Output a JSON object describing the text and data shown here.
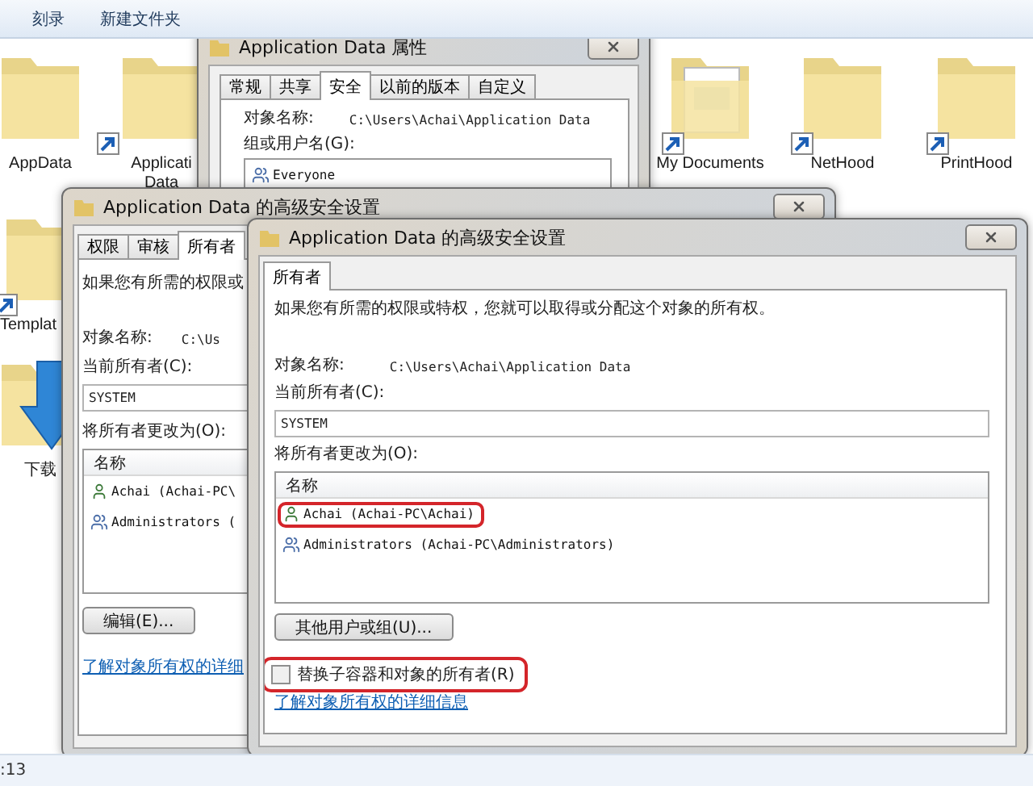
{
  "toolbar": {
    "buttons": [
      "刻录",
      "新建文件夹"
    ]
  },
  "files": [
    {
      "name": "AppData",
      "kind": "folder",
      "shortcut": false
    },
    {
      "name": "Applicati\nData",
      "kind": "folder",
      "shortcut": true
    },
    {
      "name": "My Documents",
      "kind": "documents",
      "shortcut": true
    },
    {
      "name": "NetHood",
      "kind": "folder",
      "shortcut": true
    },
    {
      "name": "PrintHood",
      "kind": "folder",
      "shortcut": true
    },
    {
      "name": "Templat",
      "kind": "folder",
      "shortcut": true
    },
    {
      "name": "下载",
      "kind": "download",
      "shortcut": false
    }
  ],
  "status_bar": {
    "text": ":13"
  },
  "windows": [
    {
      "kind": "properties",
      "title": "Application Data 属性",
      "tabs": [
        {
          "label": "常规",
          "selected": false
        },
        {
          "label": "共享",
          "selected": false
        },
        {
          "label": "安全",
          "selected": true
        },
        {
          "label": "以前的版本",
          "selected": false
        },
        {
          "label": "自定义",
          "selected": false
        }
      ],
      "object_label": "对象名称:",
      "object_path": "C:\\Users\\Achai\\Application Data",
      "group_label": "组或用户名(G):",
      "users": [
        {
          "name": "Everyone",
          "kind": "group"
        }
      ]
    },
    {
      "kind": "advanced",
      "title": "Application Data 的高级安全设置",
      "tabs": [
        {
          "label": "权限",
          "selected": false
        },
        {
          "label": "审核",
          "selected": false
        },
        {
          "label": "所有者",
          "selected": true
        }
      ],
      "intro": "如果您有所需的权限或",
      "object_label": "对象名称:",
      "object_path": "C:\\Us",
      "owner_label": "当前所有者(C):",
      "owner_value": "SYSTEM",
      "change_label": "将所有者更改为(O):",
      "list_header": "名称",
      "candidates": [
        {
          "name": "Achai (Achai-PC\\",
          "kind": "user",
          "highlighted": false
        },
        {
          "name": "Administrators (",
          "kind": "group",
          "highlighted": false
        }
      ],
      "button": "编辑(E)...",
      "link": "了解对象所有权的详细"
    },
    {
      "kind": "advanced",
      "title": "Application Data 的高级安全设置",
      "tabs": [
        {
          "label": "所有者",
          "selected": true
        }
      ],
      "intro": "如果您有所需的权限或特权，您就可以取得或分配这个对象的所有权。",
      "object_label": "对象名称:",
      "object_path": "C:\\Users\\Achai\\Application Data",
      "owner_label": "当前所有者(C):",
      "owner_value": "SYSTEM",
      "change_label": "将所有者更改为(O):",
      "list_header": "名称",
      "candidates": [
        {
          "name": "Achai (Achai-PC\\Achai)",
          "kind": "user",
          "highlighted": true
        },
        {
          "name": "Administrators (Achai-PC\\Administrators)",
          "kind": "group",
          "highlighted": false
        }
      ],
      "button": "其他用户或组(U)...",
      "checkbox": {
        "label": "替换子容器和对象的所有者(R)",
        "checked": false,
        "highlighted": true
      },
      "link": "了解对象所有权的详细信息"
    }
  ]
}
